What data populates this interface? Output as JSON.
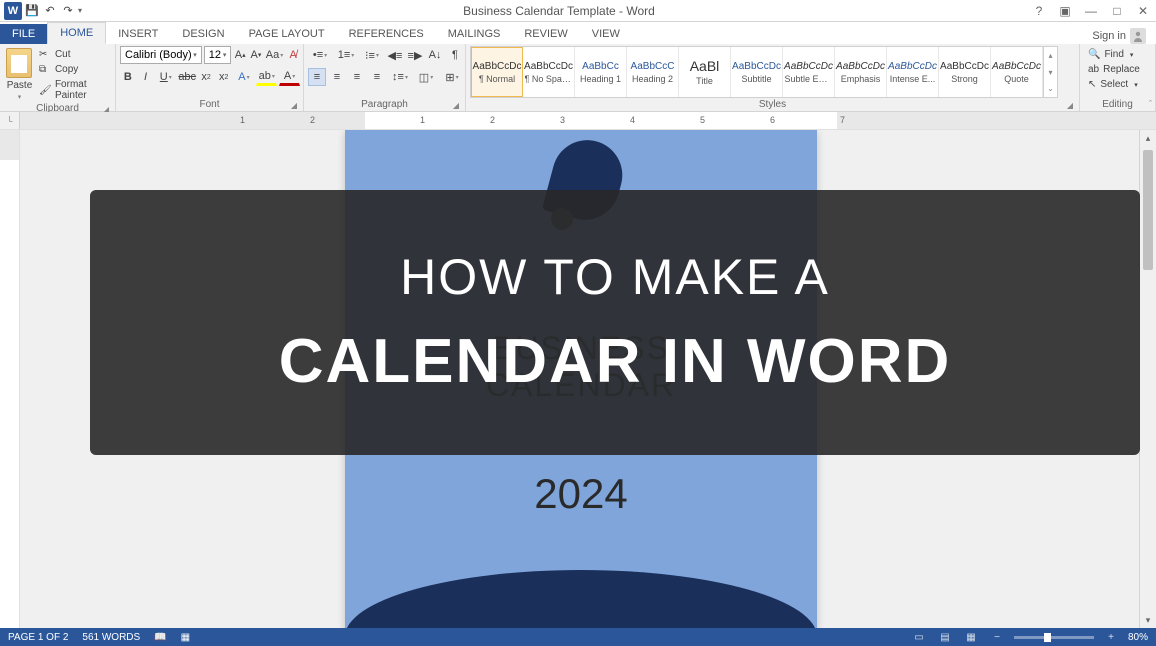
{
  "titlebar": {
    "app_letter": "W",
    "title": "Business Calendar Template - Word",
    "help_icon": "?",
    "sign_in": "Sign in"
  },
  "tabs": {
    "file": "FILE",
    "items": [
      "HOME",
      "INSERT",
      "DESIGN",
      "PAGE LAYOUT",
      "REFERENCES",
      "MAILINGS",
      "REVIEW",
      "VIEW"
    ],
    "active_index": 0
  },
  "ribbon": {
    "clipboard": {
      "paste": "Paste",
      "cut": "Cut",
      "copy": "Copy",
      "format_painter": "Format Painter",
      "label": "Clipboard"
    },
    "font": {
      "family": "Calibri (Body)",
      "size": "12",
      "label": "Font"
    },
    "paragraph": {
      "label": "Paragraph"
    },
    "styles": {
      "items": [
        {
          "preview": "AaBbCcDc",
          "name": "¶ Normal",
          "cls": ""
        },
        {
          "preview": "AaBbCcDc",
          "name": "¶ No Spac...",
          "cls": ""
        },
        {
          "preview": "AaBbCc",
          "name": "Heading 1",
          "cls": "blue"
        },
        {
          "preview": "AaBbCcC",
          "name": "Heading 2",
          "cls": "blue"
        },
        {
          "preview": "AaBl",
          "name": "Title",
          "cls": "title"
        },
        {
          "preview": "AaBbCcDc",
          "name": "Subtitle",
          "cls": "blue"
        },
        {
          "preview": "AaBbCcDc",
          "name": "Subtle Em...",
          "cls": "italic"
        },
        {
          "preview": "AaBbCcDc",
          "name": "Emphasis",
          "cls": "italic"
        },
        {
          "preview": "AaBbCcDc",
          "name": "Intense E...",
          "cls": "blue italic"
        },
        {
          "preview": "AaBbCcDc",
          "name": "Strong",
          "cls": ""
        },
        {
          "preview": "AaBbCcDc",
          "name": "Quote",
          "cls": "italic"
        }
      ],
      "label": "Styles"
    },
    "editing": {
      "find": "Find",
      "replace": "Replace",
      "select": "Select",
      "label": "Editing"
    }
  },
  "ruler": {
    "numbers": [
      "1",
      "2",
      "1",
      "2",
      "3",
      "4",
      "5",
      "6",
      "7"
    ]
  },
  "document": {
    "title_line1": "BUSINESS",
    "title_line2": "CALENDAR",
    "year": "2024"
  },
  "overlay": {
    "line1": "HOW TO MAKE A",
    "line2": "CALENDAR IN WORD"
  },
  "statusbar": {
    "page": "PAGE 1 OF 2",
    "words": "561 WORDS",
    "zoom": "80%"
  }
}
